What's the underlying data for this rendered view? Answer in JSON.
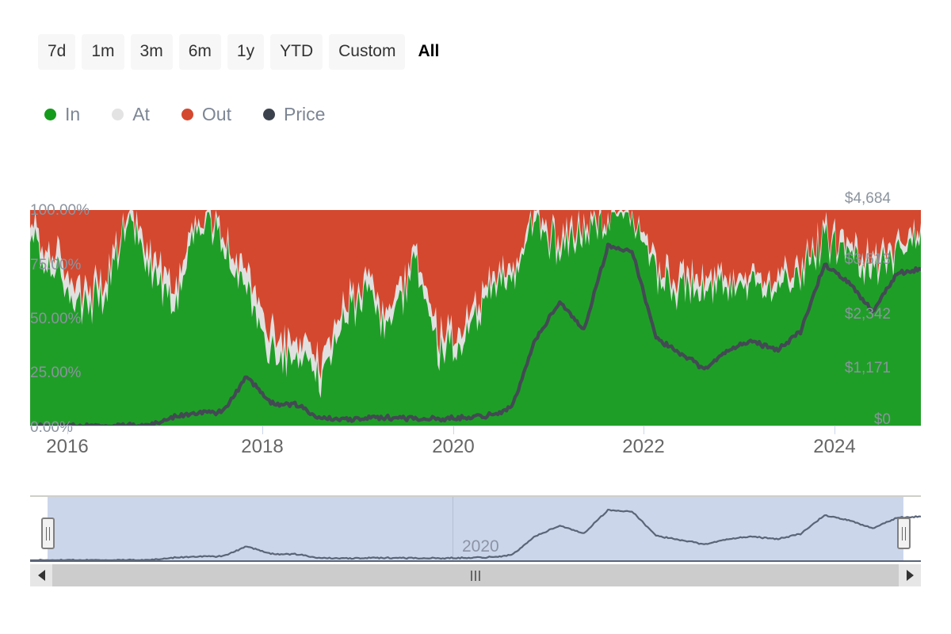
{
  "range_selector": {
    "buttons": [
      {
        "label": "7d",
        "active": false
      },
      {
        "label": "1m",
        "active": false
      },
      {
        "label": "3m",
        "active": false
      },
      {
        "label": "6m",
        "active": false
      },
      {
        "label": "1y",
        "active": false
      },
      {
        "label": "YTD",
        "active": false
      },
      {
        "label": "Custom",
        "active": false
      },
      {
        "label": "All",
        "active": true
      }
    ]
  },
  "legend": {
    "items": [
      {
        "label": "In",
        "color": "#159b1c"
      },
      {
        "label": "At",
        "color": "#e3e3e3"
      },
      {
        "label": "Out",
        "color": "#d4482f"
      },
      {
        "label": "Price",
        "color": "#3c424d"
      }
    ]
  },
  "navigator": {
    "year_label": "2020",
    "left_handle_name": "left-drag-handle",
    "right_handle_name": "right-drag-handle",
    "scroll_left_label": "◀",
    "scroll_right_label": "▶"
  },
  "colors": {
    "in": "#1f9e27",
    "at": "#e0e0e0",
    "out": "#d4482f",
    "price": "#434a54",
    "axis_text": "#8b949e",
    "x_text": "#666666",
    "nav_fill": "#ccd6eb",
    "nav_line": "#5b6578",
    "scrollbar": "#cccccc"
  },
  "chart_data": {
    "type": "area",
    "title": "",
    "subtitle": "",
    "xlabel": "",
    "ylabel": "",
    "grid": false,
    "legend_position": "top-left",
    "stacked": true,
    "stack_unit": "percent",
    "x": [
      2015.75,
      2016.0,
      2016.25,
      2016.5,
      2016.75,
      2017.0,
      2017.25,
      2017.5,
      2017.75,
      2018.0,
      2018.25,
      2018.5,
      2018.75,
      2019.0,
      2019.25,
      2019.5,
      2019.75,
      2020.0,
      2020.25,
      2020.5,
      2020.75,
      2021.0,
      2021.25,
      2021.5,
      2021.75,
      2022.0,
      2022.25,
      2022.5,
      2022.75,
      2023.0,
      2023.25,
      2023.5,
      2023.75,
      2024.0,
      2024.25,
      2024.5,
      2024.75,
      2025.0
    ],
    "x_axis": {
      "ticks": [
        2016,
        2018,
        2020,
        2022,
        2024
      ],
      "tick_labels": [
        "2016",
        "2018",
        "2020",
        "2022",
        "2024"
      ],
      "range": [
        2015.6,
        2025.2
      ]
    },
    "y_axis_left": {
      "ticks": [
        0,
        25,
        50,
        75,
        100
      ],
      "tick_labels": [
        "0.00%",
        "25.00%",
        "50.00%",
        "75.00%",
        "100.00%"
      ],
      "range": [
        0,
        100
      ],
      "unit": "%"
    },
    "y_axis_right": {
      "ticks": [
        0,
        1171,
        2342,
        3513,
        4684
      ],
      "tick_labels": [
        "$0",
        "$1,171",
        "$2,342",
        "$3,513",
        "$4,684"
      ],
      "range": [
        0,
        4684
      ],
      "unit": "USD"
    },
    "series": [
      {
        "name": "In",
        "type": "area",
        "color": "#1f9e27",
        "values": [
          88,
          72,
          55,
          60,
          95,
          72,
          58,
          97,
          84,
          62,
          34,
          30,
          22,
          48,
          62,
          44,
          78,
          32,
          40,
          58,
          70,
          92,
          84,
          88,
          96,
          98,
          70,
          62,
          60,
          66,
          68,
          62,
          72,
          86,
          80,
          72,
          78,
          90
        ]
      },
      {
        "name": "At",
        "type": "area",
        "color": "#e0e0e0",
        "values": [
          6,
          8,
          9,
          7,
          4,
          8,
          9,
          3,
          6,
          9,
          10,
          8,
          9,
          7,
          6,
          7,
          5,
          8,
          7,
          6,
          5,
          4,
          5,
          5,
          3,
          2,
          5,
          6,
          6,
          5,
          5,
          6,
          5,
          4,
          5,
          6,
          5,
          4
        ]
      },
      {
        "name": "Out",
        "type": "area",
        "color": "#d4482f",
        "values": [
          6,
          20,
          36,
          33,
          1,
          20,
          33,
          0,
          10,
          29,
          56,
          62,
          69,
          45,
          32,
          49,
          17,
          60,
          53,
          36,
          25,
          4,
          11,
          7,
          1,
          0,
          25,
          32,
          34,
          29,
          27,
          32,
          23,
          10,
          15,
          22,
          17,
          6
        ]
      },
      {
        "name": "Price",
        "type": "line",
        "color": "#434a54",
        "axis": "right",
        "values": [
          1,
          5,
          12,
          13,
          8,
          30,
          200,
          300,
          310,
          1100,
          500,
          470,
          200,
          140,
          170,
          190,
          180,
          150,
          200,
          230,
          390,
          1900,
          2700,
          2100,
          3900,
          3800,
          1900,
          1600,
          1250,
          1650,
          1850,
          1650,
          2050,
          3500,
          3100,
          2500,
          3300,
          3400
        ]
      }
    ]
  }
}
